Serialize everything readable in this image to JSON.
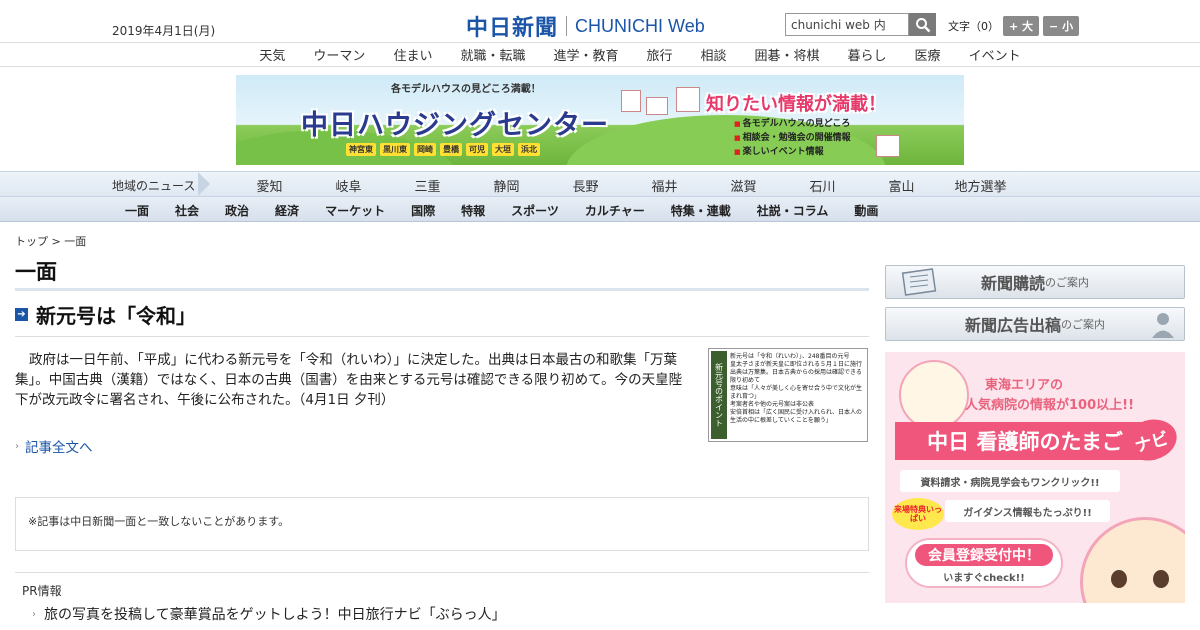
{
  "header": {
    "date": "2019年4月1日(月)",
    "logo_kanji": "中日新聞",
    "logo_en": "CHUNICHI",
    "logo_web": "Web",
    "search_value": "chunichi web 内",
    "font_size_label": "文字（0）",
    "font_bigger": "+ 大",
    "font_smaller": "− 小"
  },
  "topnav": [
    "天気",
    "ウーマン",
    "住まい",
    "就職・転職",
    "進学・教育",
    "旅行",
    "相談",
    "囲碁・将棋",
    "暮らし",
    "医療",
    "イベント"
  ],
  "banner": {
    "top_text": "各モデルハウスの見どころ満載！",
    "main_text": "中日ハウジングセンター",
    "tags": [
      "神宮東",
      "黒川東",
      "岡崎",
      "豊橋",
      "可児",
      "大垣",
      "浜北"
    ],
    "right_title": "知りたい情報が満載！",
    "right_list": [
      "各モデルハウスの見どころ",
      "相談会・勉強会の開催情報",
      "楽しいイベント情報"
    ]
  },
  "region": {
    "label": "地域のニュース",
    "items": [
      "愛知",
      "岐阜",
      "三重",
      "静岡",
      "長野",
      "福井",
      "滋賀",
      "石川",
      "富山",
      "地方選挙"
    ]
  },
  "sections": [
    "一面",
    "社会",
    "政治",
    "経済",
    "マーケット",
    "国際",
    "特報",
    "スポーツ",
    "カルチャー",
    "特集・連載",
    "社説・コラム",
    "動画"
  ],
  "main": {
    "breadcrumb": "トップ > 一面",
    "page_title": "一面",
    "headline": "新元号は「令和」",
    "body": "政府は一日午前、「平成」に代わる新元号を「令和（れいわ）」に決定した。出典は日本最古の和歌集「万葉集」。中国古典（漢籍）ではなく、日本の古典（国書）を由来とする元号は確認できる限り初めて。今の天皇陛下が改元政令に署名され、午後に公布された。（4月1日 夕刊）",
    "thumb_side": "新元号のポイント",
    "thumb_lines": [
      "新元号は「令和（れいわ）」、248番目の元号",
      "皇太子さまが新天皇に即位される５月１日に施行",
      "出典は万葉集。日本古典からの採用は確認できる限り初めて",
      "意味は「人々が美しく心を寄せ合う中で文化が生まれ育つ」",
      "考案者名や他の元号案は非公表",
      "安倍首相は「広く国民に受け入れられ、日本人の生活の中に根差していくことを願う」"
    ],
    "more_link": "記事全文へ",
    "note": "※記事は中日新聞一面と一致しないことがあります。",
    "pr_label": "PR情報",
    "pr_link": "旅の写真を投稿して豪華賞品をゲットしよう！中日旅行ナビ「ぶらっ人」"
  },
  "sidebar": {
    "subscribe": "新聞購読",
    "subscribe_suffix": "のご案内",
    "ads": "新聞広告出稿",
    "ads_suffix": "のご案内",
    "ad": {
      "line1": "東海エリアの",
      "line2": "人気病院の情報が100以上!!",
      "main": "中日 看護師のたまご",
      "bubble": "ナビ",
      "bar1": "資料請求・病院見学会もワンクリック!!",
      "tag": "来場特典いっぱい",
      "bar2": "ガイダンス情報もたっぷり!!",
      "cta1": "会員登録受付中！",
      "cta2": "いますぐcheck!!"
    }
  },
  "colors": {
    "brand": "#1a55a8",
    "accent_pink": "#f0567c"
  }
}
